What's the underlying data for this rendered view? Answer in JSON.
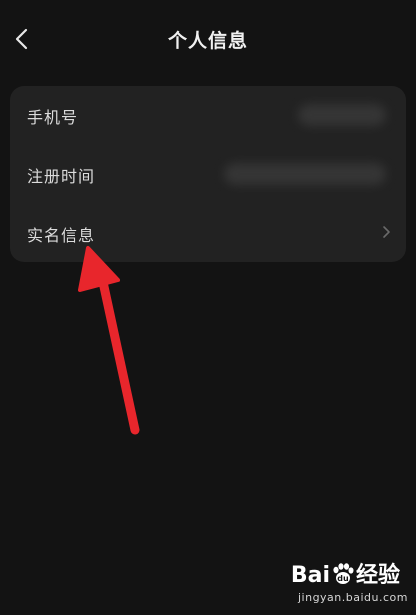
{
  "header": {
    "title": "个人信息",
    "back_icon": "chevron-left-icon"
  },
  "info_card": {
    "rows": [
      {
        "label": "手机号",
        "value_visibility": "blurred",
        "chevron": false
      },
      {
        "label": "注册时间",
        "value_visibility": "blurred",
        "chevron": false
      },
      {
        "label": "实名信息",
        "chevron": true,
        "chevron_icon": "chevron-right-icon"
      }
    ]
  },
  "annotation": {
    "type": "red-arrow",
    "color": "#e8262c",
    "points_to": "实名信息"
  },
  "watermark": {
    "logo": "Bai经验",
    "url": "jingyan.baidu.com"
  },
  "colors": {
    "background": "#131313",
    "card": "#222222",
    "text": "#dcdcdc",
    "arrow": "#e8262c"
  }
}
